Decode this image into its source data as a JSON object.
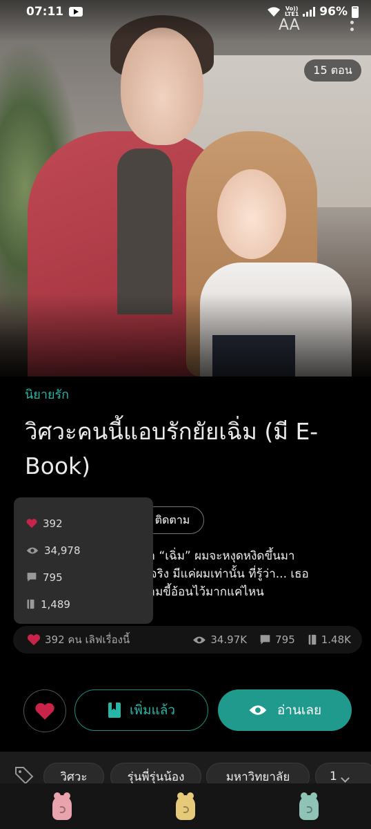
{
  "status_bar": {
    "time": "07:11",
    "lte_top": "Vo))",
    "lte_bottom": "LTE1",
    "battery": "96%"
  },
  "header": {
    "font_button": "AA",
    "episodes": "15 ตอน"
  },
  "story": {
    "category": "นิยายรัก",
    "title": "วิศวะคนนี้แอบรักยัยเฉิ่ม (มี E-Book)",
    "follow": "ติดตาม",
    "synopsis": "ว่า “เฉิ่ม” ผมจะหงุดหงิดขึ้นมา\nนจริง มีแค่ผมเท่านั้น ที่รู้ว่า... เธอ\nวามขี้อ้อนไว้มากแค่ไหน"
  },
  "stats_popup": {
    "likes": "392",
    "views": "34,978",
    "comments": "795",
    "library": "1,489"
  },
  "summary": {
    "likes_text": "392 คน เลิฟเรื่องนี้",
    "views": "34.97K",
    "comments": "795",
    "library": "1.48K"
  },
  "actions": {
    "added": "เพิ่มแล้ว",
    "read": "อ่านเลย"
  },
  "tags": [
    "วิศวะ",
    "รุ่นพี่รุ่นน้อง",
    "มหาวิทยาลัย",
    "1"
  ],
  "colors": {
    "accent": "#1f9a8c",
    "heart": "#c8244a"
  },
  "bottom_nav": [
    {
      "icon": "pink-mascot-icon",
      "color": "#e8a3ad"
    },
    {
      "icon": "yellow-mascot-icon",
      "color": "#e7c97a"
    },
    {
      "icon": "teal-mascot-icon",
      "color": "#8fc3b6"
    }
  ]
}
